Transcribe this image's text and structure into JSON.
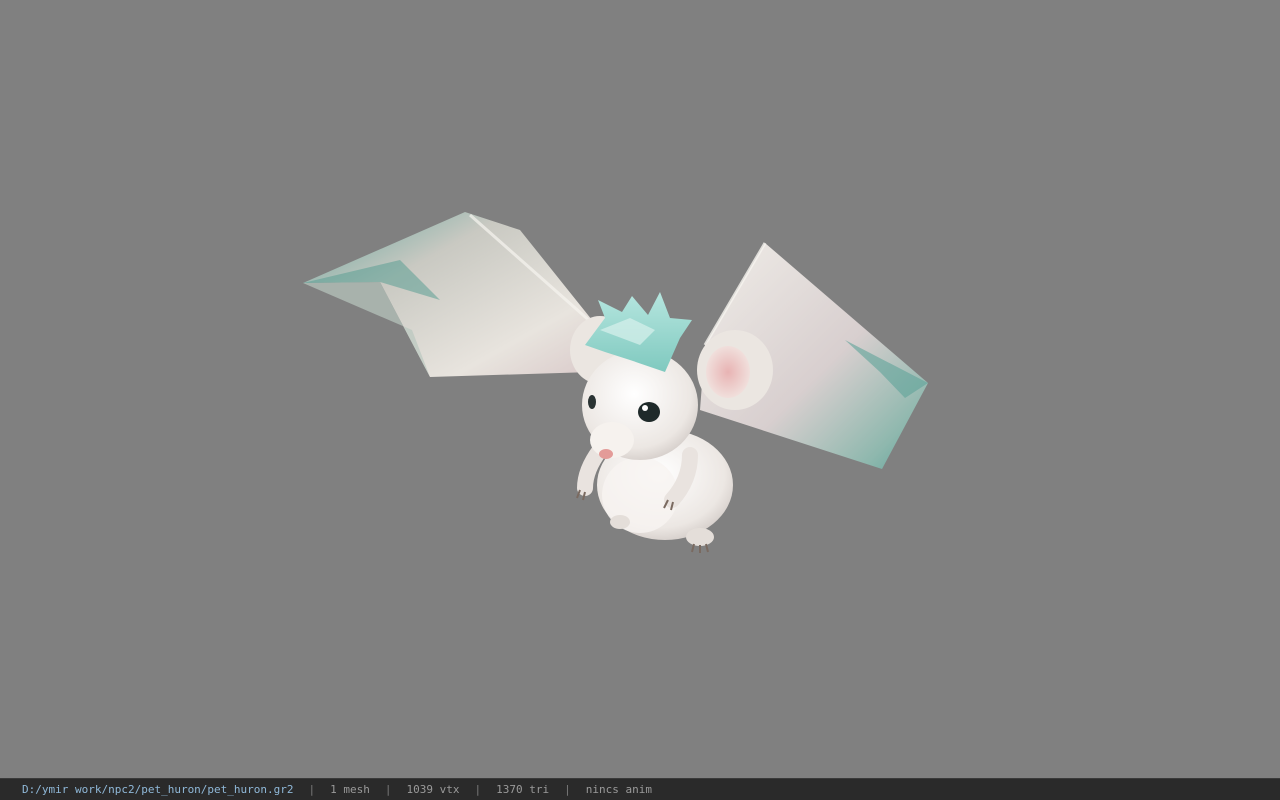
{
  "viewer": {
    "model_name": "pet_huron",
    "colors": {
      "background": "#808080",
      "statusbar_bg": "#2a2a2a",
      "path_text": "#8fb8d8",
      "stat_text": "#9a9a9a"
    }
  },
  "statusbar": {
    "file_path": "D:/ymir work/npc2/pet_huron/pet_huron.gr2",
    "separator": "|",
    "mesh_count": "1 mesh",
    "vertex_count": "1039 vtx",
    "triangle_count": "1370 tri",
    "anim_status": "nincs anim"
  }
}
